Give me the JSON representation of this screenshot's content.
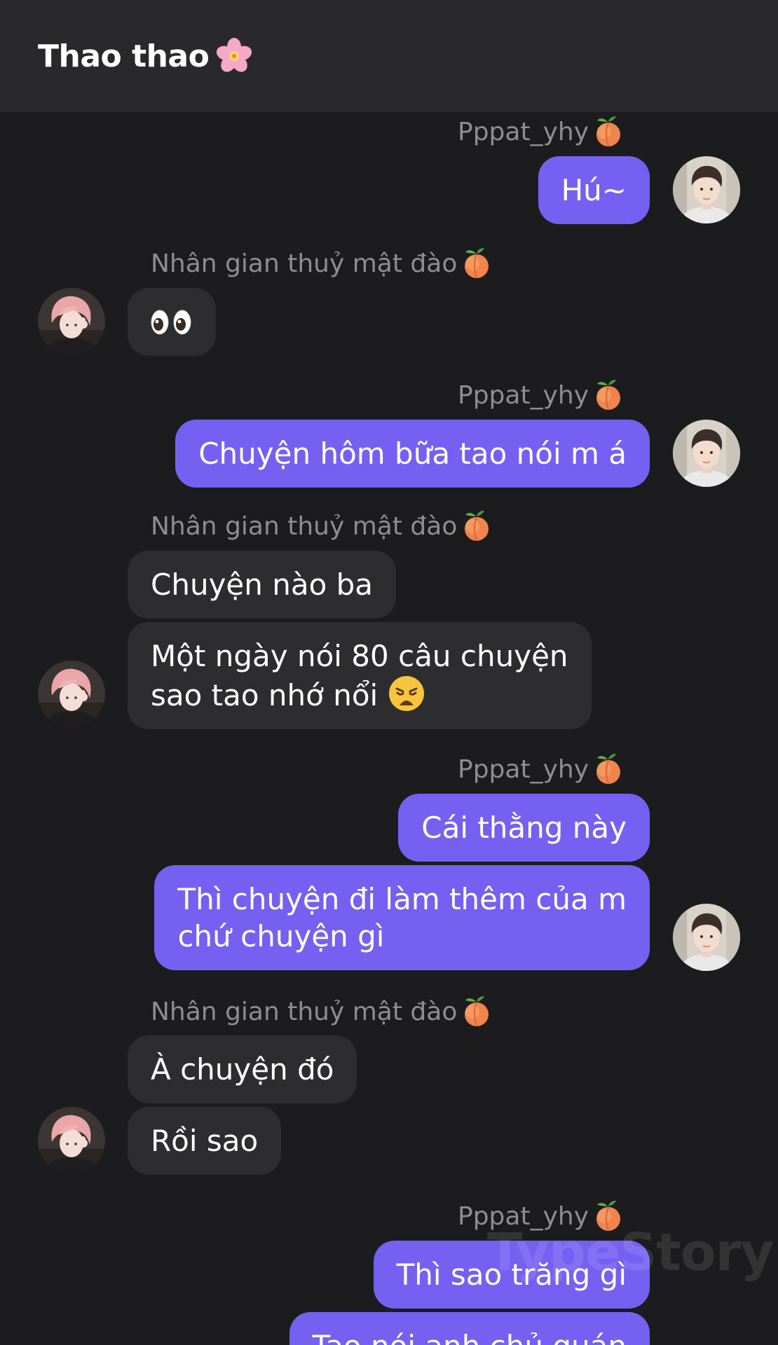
{
  "header": {
    "title": "Thao thao",
    "title_emoji": "cherry-blossom-icon"
  },
  "contacts": {
    "me": "Pppat_yhy",
    "other": "Nhân gian thuỷ mật đào",
    "name_emoji": "peach-icon"
  },
  "messages": [
    {
      "side": "out",
      "text": "Hú~"
    },
    {
      "side": "in",
      "text": "👀"
    },
    {
      "side": "out",
      "text": "Chuyện hôm bữa tao nói m á"
    },
    {
      "side": "in",
      "text": "Chuyện nào ba"
    },
    {
      "side": "in",
      "line1": "Một ngày nói 80 câu chuyện",
      "line2": "sao tao nhớ nổi",
      "emoji": "weary-face-icon"
    },
    {
      "side": "out",
      "text": "Cái thằng này"
    },
    {
      "side": "out",
      "line1": "Thì chuyện đi làm thêm của m",
      "line2": "chứ chuyện gì"
    },
    {
      "side": "in",
      "text": "À chuyện đó"
    },
    {
      "side": "in",
      "text": "Rồi sao"
    },
    {
      "side": "out",
      "text": "Thì sao trăng gì"
    },
    {
      "side": "out",
      "text": "Tao nói anh chủ quán"
    }
  ],
  "watermark": "TypeStory",
  "colors": {
    "background": "#1c1c1e",
    "header": "#29292c",
    "outgoing_bubble": "#7560f1",
    "incoming_bubble": "#2d2d30",
    "sender_name": "#8d8d92"
  }
}
